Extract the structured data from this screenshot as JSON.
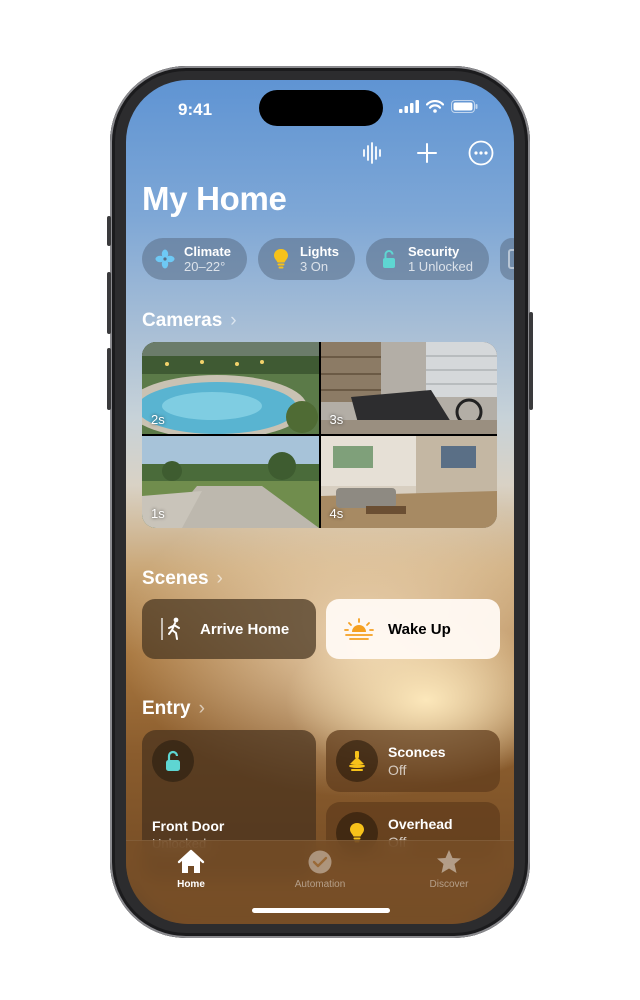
{
  "status_bar": {
    "time": "9:41"
  },
  "header": {
    "title": "My Home",
    "actions": [
      {
        "icon": "voice-waveform-icon"
      },
      {
        "icon": "plus-icon"
      },
      {
        "icon": "more-ellipsis-icon"
      }
    ]
  },
  "chips": [
    {
      "label": "Climate",
      "value": "20–22°",
      "icon": "fan-icon"
    },
    {
      "label": "Lights",
      "value": "3 On",
      "icon": "lightbulb-icon"
    },
    {
      "label": "Security",
      "value": "1 Unlocked",
      "icon": "lock-icon"
    }
  ],
  "cameras": {
    "title": "Cameras",
    "feeds": [
      {
        "age": "2s",
        "scene": "backyard-pool"
      },
      {
        "age": "3s",
        "scene": "garage-gym"
      },
      {
        "age": "1s",
        "scene": "front-driveway"
      },
      {
        "age": "4s",
        "scene": "living-room"
      }
    ]
  },
  "scenes": {
    "title": "Scenes",
    "items": [
      {
        "label": "Arrive Home",
        "icon": "person-walking-icon",
        "active": false
      },
      {
        "label": "Wake Up",
        "icon": "sunrise-icon",
        "active": true
      }
    ]
  },
  "entry": {
    "title": "Entry",
    "front_door": {
      "name": "Front Door",
      "state": "Unlocked"
    },
    "accessories": [
      {
        "name": "Sconces",
        "state": "Off",
        "icon": "sconce-lamp-icon"
      },
      {
        "name": "Overhead",
        "state": "Off",
        "icon": "lightbulb-icon"
      }
    ]
  },
  "tabs": [
    {
      "label": "Home",
      "selected": true
    },
    {
      "label": "Automation",
      "selected": false
    },
    {
      "label": "Discover",
      "selected": false
    }
  ],
  "colors": {
    "accent_teal": "#5ed6d2",
    "bulb_yellow": "#f7c21a",
    "sunrise_orange": "#f5a020"
  }
}
